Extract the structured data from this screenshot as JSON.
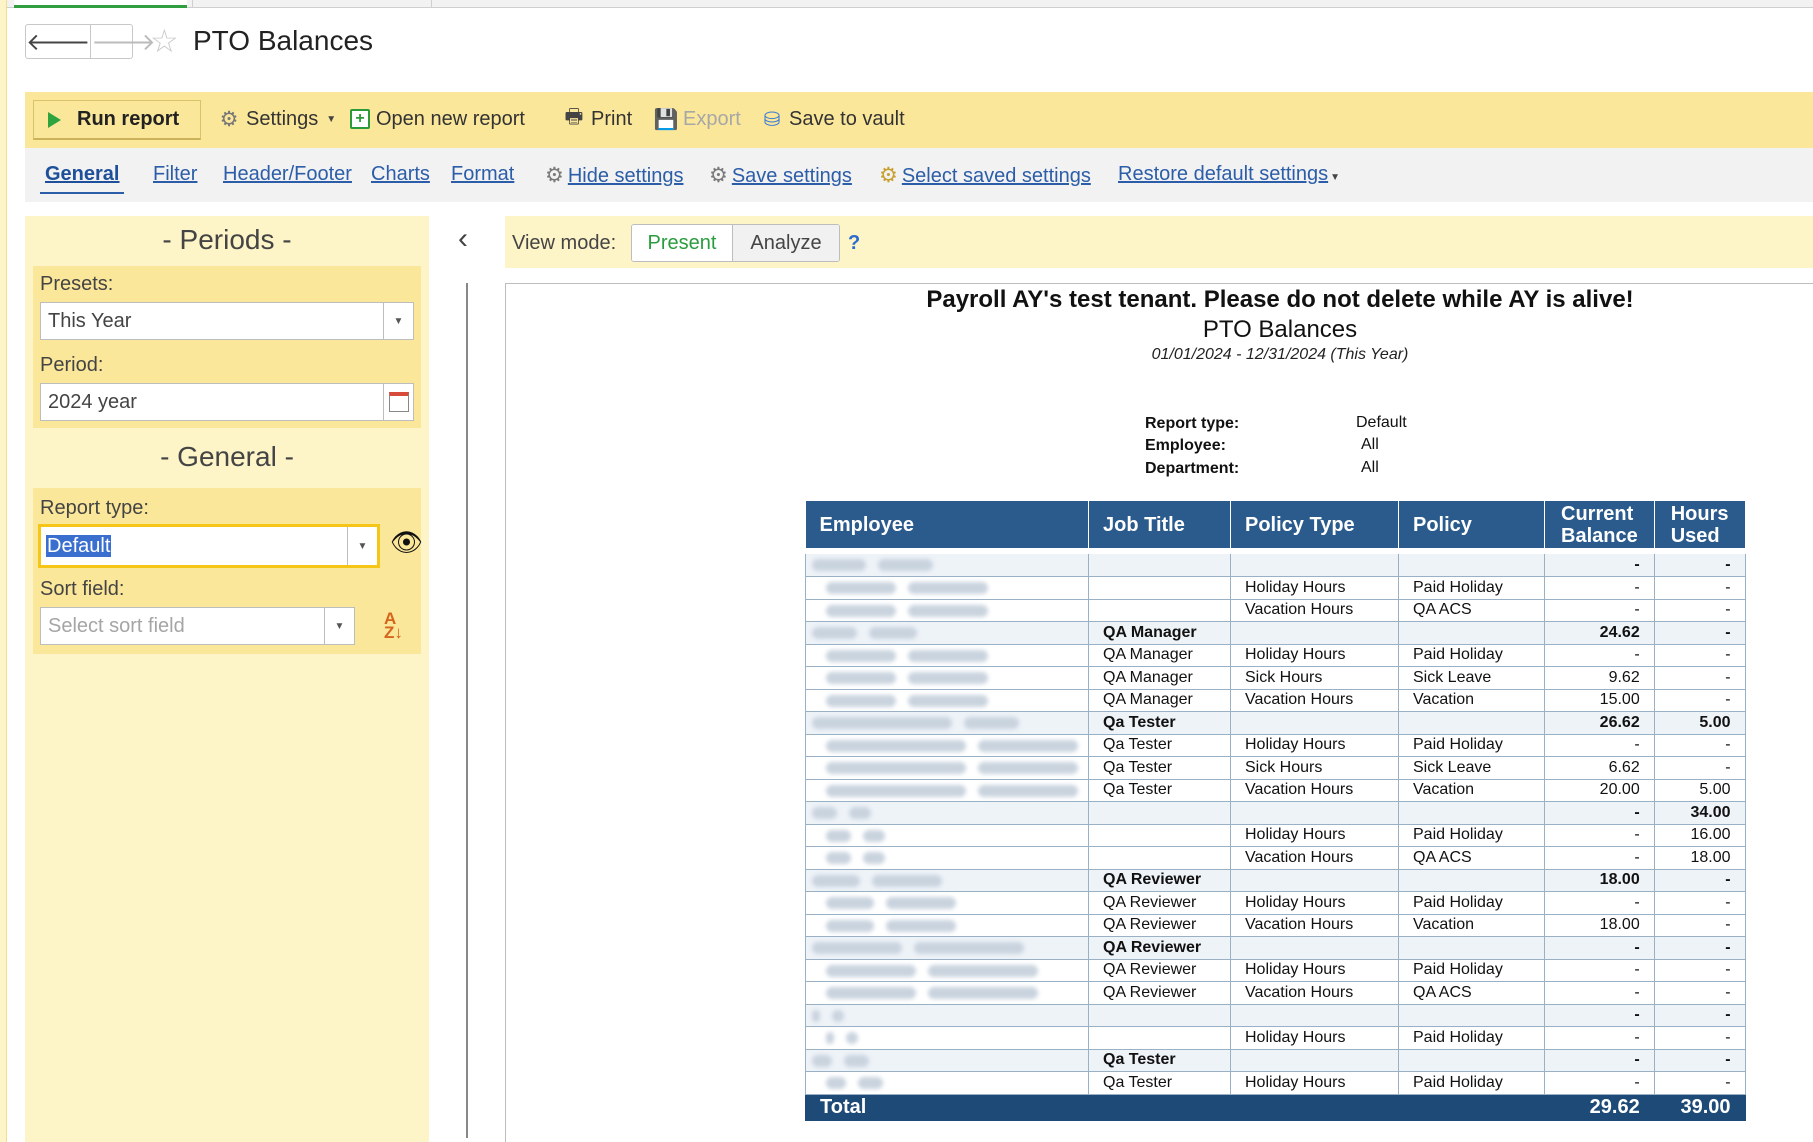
{
  "window": {
    "title": "PTO Balances"
  },
  "toolbar": {
    "run_label": "Run report",
    "settings_label": "Settings",
    "open_new_label": "Open new report",
    "print_label": "Print",
    "export_label": "Export",
    "save_vault_label": "Save to vault"
  },
  "tabs": {
    "general": "General",
    "filter": "Filter",
    "header_footer": "Header/Footer",
    "charts": "Charts",
    "format": "Format",
    "hide_settings": "Hide settings",
    "save_settings": "Save settings",
    "select_saved": "Select saved settings",
    "restore_default": "Restore default settings"
  },
  "settings_panel": {
    "periods_title": "- Periods -",
    "presets_label": "Presets:",
    "presets_value": "This Year",
    "period_label": "Period:",
    "period_value": "2024 year",
    "general_title": "- General -",
    "report_type_label": "Report type:",
    "report_type_value": "Default",
    "sort_field_label": "Sort field:",
    "sort_field_placeholder": "Select sort field"
  },
  "view_mode": {
    "label": "View mode:",
    "present": "Present",
    "analyze": "Analyze",
    "help": "?"
  },
  "report": {
    "org_title": "Payroll AY's test tenant. Please do not delete while AY is alive!",
    "report_name": "PTO Balances",
    "period": "01/01/2024 - 12/31/2024 (This Year)",
    "params": [
      {
        "label": "Report type:",
        "value": "Default"
      },
      {
        "label": "Employee:",
        "value": "All"
      },
      {
        "label": "Department:",
        "value": "All"
      }
    ],
    "columns": {
      "employee": "Employee",
      "job_title": "Job Title",
      "policy_type": "Policy Type",
      "policy": "Policy",
      "current_balance_1": "Current",
      "current_balance_2": "Balance",
      "hours_used_1": "Hours",
      "hours_used_2": "Used"
    },
    "rows": [
      {
        "job": "",
        "ptype": "",
        "policy": "",
        "bal": "-",
        "used": "-"
      },
      {
        "job": "",
        "ptype": "Holiday Hours",
        "policy": "Paid Holiday",
        "bal": "-",
        "used": "-"
      },
      {
        "job": "",
        "ptype": "Vacation Hours",
        "policy": "QA ACS",
        "bal": "-",
        "used": "-"
      },
      {
        "job": "QA Manager",
        "ptype": "",
        "policy": "",
        "bal": "24.62",
        "used": "-"
      },
      {
        "job": "QA Manager",
        "ptype": "Holiday Hours",
        "policy": "Paid Holiday",
        "bal": "-",
        "used": "-"
      },
      {
        "job": "QA Manager",
        "ptype": "Sick Hours",
        "policy": "Sick Leave",
        "bal": "9.62",
        "used": "-"
      },
      {
        "job": "QA Manager",
        "ptype": "Vacation Hours",
        "policy": "Vacation",
        "bal": "15.00",
        "used": "-"
      },
      {
        "job": "Qa Tester",
        "ptype": "",
        "policy": "",
        "bal": "26.62",
        "used": "5.00"
      },
      {
        "job": "Qa Tester",
        "ptype": "Holiday Hours",
        "policy": "Paid Holiday",
        "bal": "-",
        "used": "-"
      },
      {
        "job": "Qa Tester",
        "ptype": "Sick Hours",
        "policy": "Sick Leave",
        "bal": "6.62",
        "used": "-"
      },
      {
        "job": "Qa Tester",
        "ptype": "Vacation Hours",
        "policy": "Vacation",
        "bal": "20.00",
        "used": "5.00"
      },
      {
        "job": "",
        "ptype": "",
        "policy": "",
        "bal": "-",
        "used": "34.00"
      },
      {
        "job": "",
        "ptype": "Holiday Hours",
        "policy": "Paid Holiday",
        "bal": "-",
        "used": "16.00"
      },
      {
        "job": "",
        "ptype": "Vacation Hours",
        "policy": "QA ACS",
        "bal": "-",
        "used": "18.00"
      },
      {
        "job": "QA Reviewer",
        "ptype": "",
        "policy": "",
        "bal": "18.00",
        "used": "-"
      },
      {
        "job": "QA Reviewer",
        "ptype": "Holiday Hours",
        "policy": "Paid Holiday",
        "bal": "-",
        "used": "-"
      },
      {
        "job": "QA Reviewer",
        "ptype": "Vacation Hours",
        "policy": "Vacation",
        "bal": "18.00",
        "used": "-"
      },
      {
        "job": "QA Reviewer",
        "ptype": "",
        "policy": "",
        "bal": "-",
        "used": "-"
      },
      {
        "job": "QA Reviewer",
        "ptype": "Holiday Hours",
        "policy": "Paid Holiday",
        "bal": "-",
        "used": "-"
      },
      {
        "job": "QA Reviewer",
        "ptype": "Vacation Hours",
        "policy": "QA ACS",
        "bal": "-",
        "used": "-"
      },
      {
        "job": "",
        "ptype": "",
        "policy": "",
        "bal": "-",
        "used": "-"
      },
      {
        "job": "",
        "ptype": "Holiday Hours",
        "policy": "Paid Holiday",
        "bal": "-",
        "used": "-"
      },
      {
        "job": "Qa Tester",
        "ptype": "",
        "policy": "",
        "bal": "-",
        "used": "-"
      },
      {
        "job": "Qa Tester",
        "ptype": "Holiday Hours",
        "policy": "Paid Holiday",
        "bal": "-",
        "used": "-"
      }
    ],
    "total": {
      "label": "Total",
      "bal": "29.62",
      "used": "39.00"
    }
  }
}
